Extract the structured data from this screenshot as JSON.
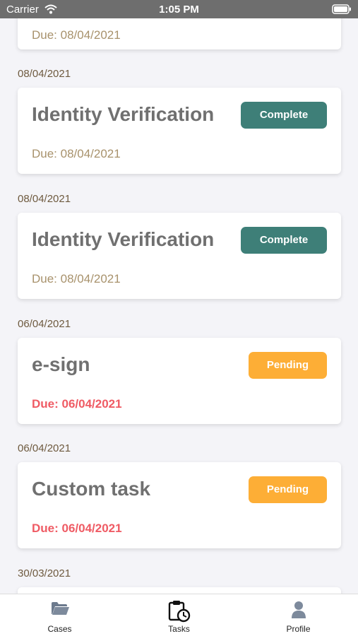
{
  "status_bar": {
    "carrier": "Carrier",
    "time": "1:05 PM",
    "wifi_icon": "wifi-icon",
    "battery_icon": "battery-icon"
  },
  "top_partial_card": {
    "due": "Due: 08/04/2021"
  },
  "groups": [
    {
      "date": "08/04/2021",
      "task": {
        "title": "Identity Verification",
        "status": "Complete",
        "due": "Due: 08/04/2021"
      }
    },
    {
      "date": "08/04/2021",
      "task": {
        "title": "Identity Verification",
        "status": "Complete",
        "due": "Due: 08/04/2021"
      }
    },
    {
      "date": "06/04/2021",
      "task": {
        "title": "e-sign",
        "status": "Pending",
        "due": "Due: 06/04/2021"
      }
    },
    {
      "date": "06/04/2021",
      "task": {
        "title": "Custom task",
        "status": "Pending",
        "due": "Due: 06/04/2021"
      }
    },
    {
      "date": "30/03/2021"
    }
  ],
  "colors": {
    "complete": "#3e7f78",
    "pending": "#fdae36",
    "overdue_text": "#ef5b64",
    "due_text": "#a8926c",
    "date_header": "#6e5a3f"
  },
  "tab_bar": {
    "tabs": [
      {
        "label": "Cases",
        "icon": "folder-icon"
      },
      {
        "label": "Tasks",
        "icon": "clipboard-clock-icon"
      },
      {
        "label": "Profile",
        "icon": "person-icon"
      }
    ]
  }
}
